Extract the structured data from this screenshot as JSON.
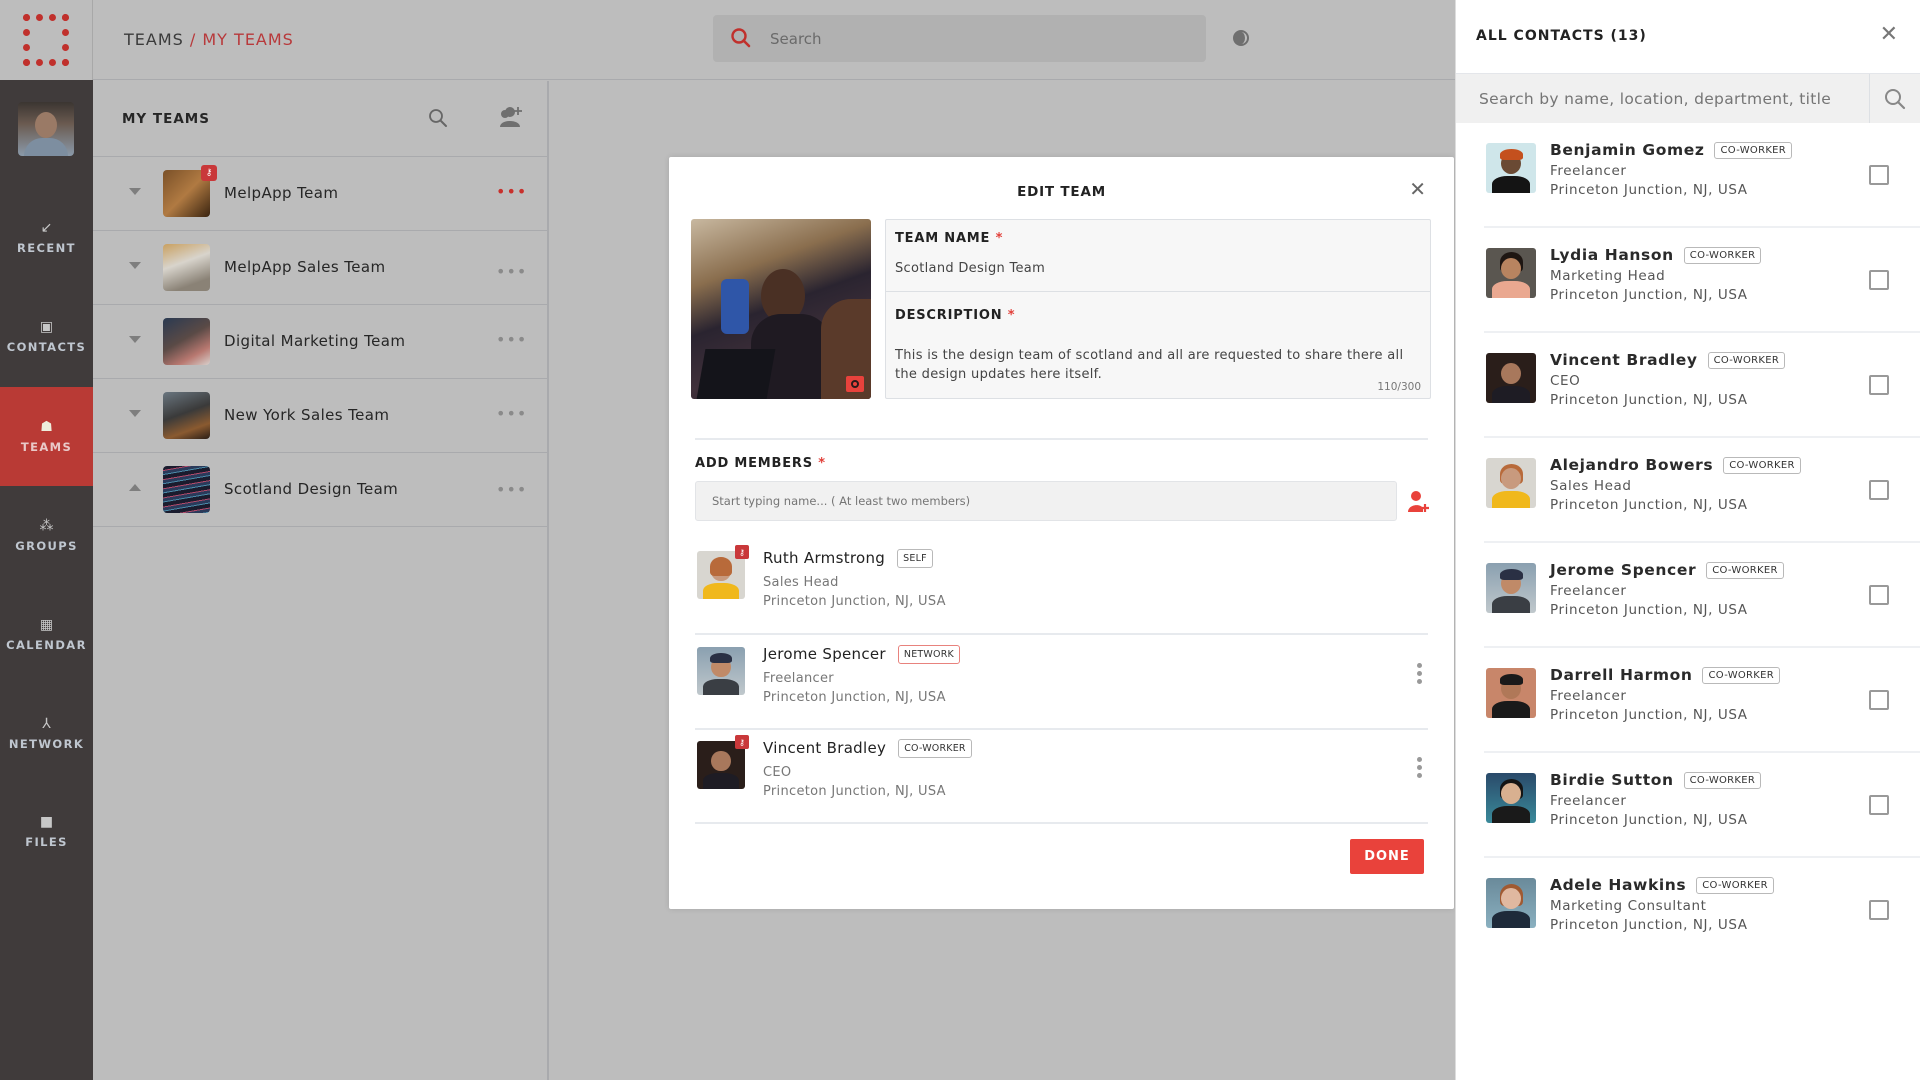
{
  "app": {
    "breadcrumb": {
      "root": "TEAMS",
      "separator": "/",
      "current": "MY TEAMS"
    },
    "search_placeholder": "Search",
    "accent_color": "#e9423b"
  },
  "nav": {
    "items": [
      {
        "id": "recent",
        "label": "RECENT",
        "icon": "arrow-down-left-icon",
        "glyph": "↙",
        "active": false
      },
      {
        "id": "contacts",
        "label": "CONTACTS",
        "icon": "contact-book-icon",
        "glyph": "▣",
        "active": false
      },
      {
        "id": "teams",
        "label": "TEAMS",
        "icon": "team-icon",
        "glyph": "☗",
        "active": true
      },
      {
        "id": "groups",
        "label": "GROUPS",
        "icon": "groups-icon",
        "glyph": "⁂",
        "active": false
      },
      {
        "id": "calendar",
        "label": "CALENDAR",
        "icon": "calendar-icon",
        "glyph": "▦",
        "active": false
      },
      {
        "id": "network",
        "label": "NETWORK",
        "icon": "network-icon",
        "glyph": "⅄",
        "active": false
      },
      {
        "id": "files",
        "label": "FILES",
        "icon": "folder-icon",
        "glyph": "■",
        "active": false
      }
    ]
  },
  "teams_panel": {
    "title": "MY TEAMS",
    "teams": [
      {
        "name": "MelpApp Team",
        "expanded": false,
        "admin": true,
        "menu_highlight": true
      },
      {
        "name": "MelpApp Sales Team",
        "expanded": false,
        "admin": false,
        "menu_highlight": false
      },
      {
        "name": "Digital Marketing Team",
        "expanded": false,
        "admin": false,
        "menu_highlight": false
      },
      {
        "name": "New York Sales Team",
        "expanded": false,
        "admin": false,
        "menu_highlight": false
      },
      {
        "name": "Scotland Design Team",
        "expanded": true,
        "admin": false,
        "menu_highlight": false
      }
    ]
  },
  "modal": {
    "title": "EDIT TEAM",
    "team_name_label": "TEAM NAME",
    "team_name_value": "Scotland Design Team",
    "description_label": "DESCRIPTION",
    "description_value": "This is the design team of scotland and all are requested to share there all the design updates here itself.",
    "description_counter": "110/300",
    "required_mark": "*",
    "add_members_label": "ADD MEMBERS",
    "add_members_placeholder": "Start typing name... ( At least two members)",
    "members": [
      {
        "name": "Ruth Armstrong",
        "tag": "SELF",
        "tag_type": "self",
        "role": "Sales Head",
        "location": "Princeton Junction, NJ, USA",
        "admin": true,
        "has_menu": false
      },
      {
        "name": "Jerome Spencer",
        "tag": "NETWORK",
        "tag_type": "network",
        "role": "Freelancer",
        "location": "Princeton Junction, NJ, USA",
        "admin": false,
        "has_menu": true
      },
      {
        "name": "Vincent Bradley",
        "tag": "CO-WORKER",
        "tag_type": "coworker",
        "role": "CEO",
        "location": "Princeton Junction, NJ, USA",
        "admin": true,
        "has_menu": true
      }
    ],
    "done_label": "DONE"
  },
  "contacts_panel": {
    "title": "ALL CONTACTS (13)",
    "search_placeholder": "Search by name, location, department, title",
    "contacts": [
      {
        "name": "Benjamin Gomez",
        "tag": "CO-WORKER",
        "role": "Freelancer",
        "location": "Princeton Junction, NJ, USA",
        "checked": false
      },
      {
        "name": "Lydia Hanson",
        "tag": "CO-WORKER",
        "role": "Marketing Head",
        "location": "Princeton Junction, NJ, USA",
        "checked": false
      },
      {
        "name": "Vincent Bradley",
        "tag": "CO-WORKER",
        "role": "CEO",
        "location": "Princeton Junction, NJ, USA",
        "checked": false
      },
      {
        "name": "Alejandro Bowers",
        "tag": "CO-WORKER",
        "role": "Sales Head",
        "location": "Princeton Junction, NJ, USA",
        "checked": false
      },
      {
        "name": "Jerome Spencer",
        "tag": "CO-WORKER",
        "role": "Freelancer",
        "location": "Princeton Junction, NJ, USA",
        "checked": false
      },
      {
        "name": "Darrell Harmon",
        "tag": "CO-WORKER",
        "role": "Freelancer",
        "location": "Princeton Junction, NJ, USA",
        "checked": false
      },
      {
        "name": "Birdie Sutton",
        "tag": "CO-WORKER",
        "role": "Freelancer",
        "location": "Princeton Junction, NJ, USA",
        "checked": false
      },
      {
        "name": "Adele Hawkins",
        "tag": "CO-WORKER",
        "role": "Marketing Consultant",
        "location": "Princeton Junction, NJ, USA",
        "checked": false
      }
    ]
  }
}
